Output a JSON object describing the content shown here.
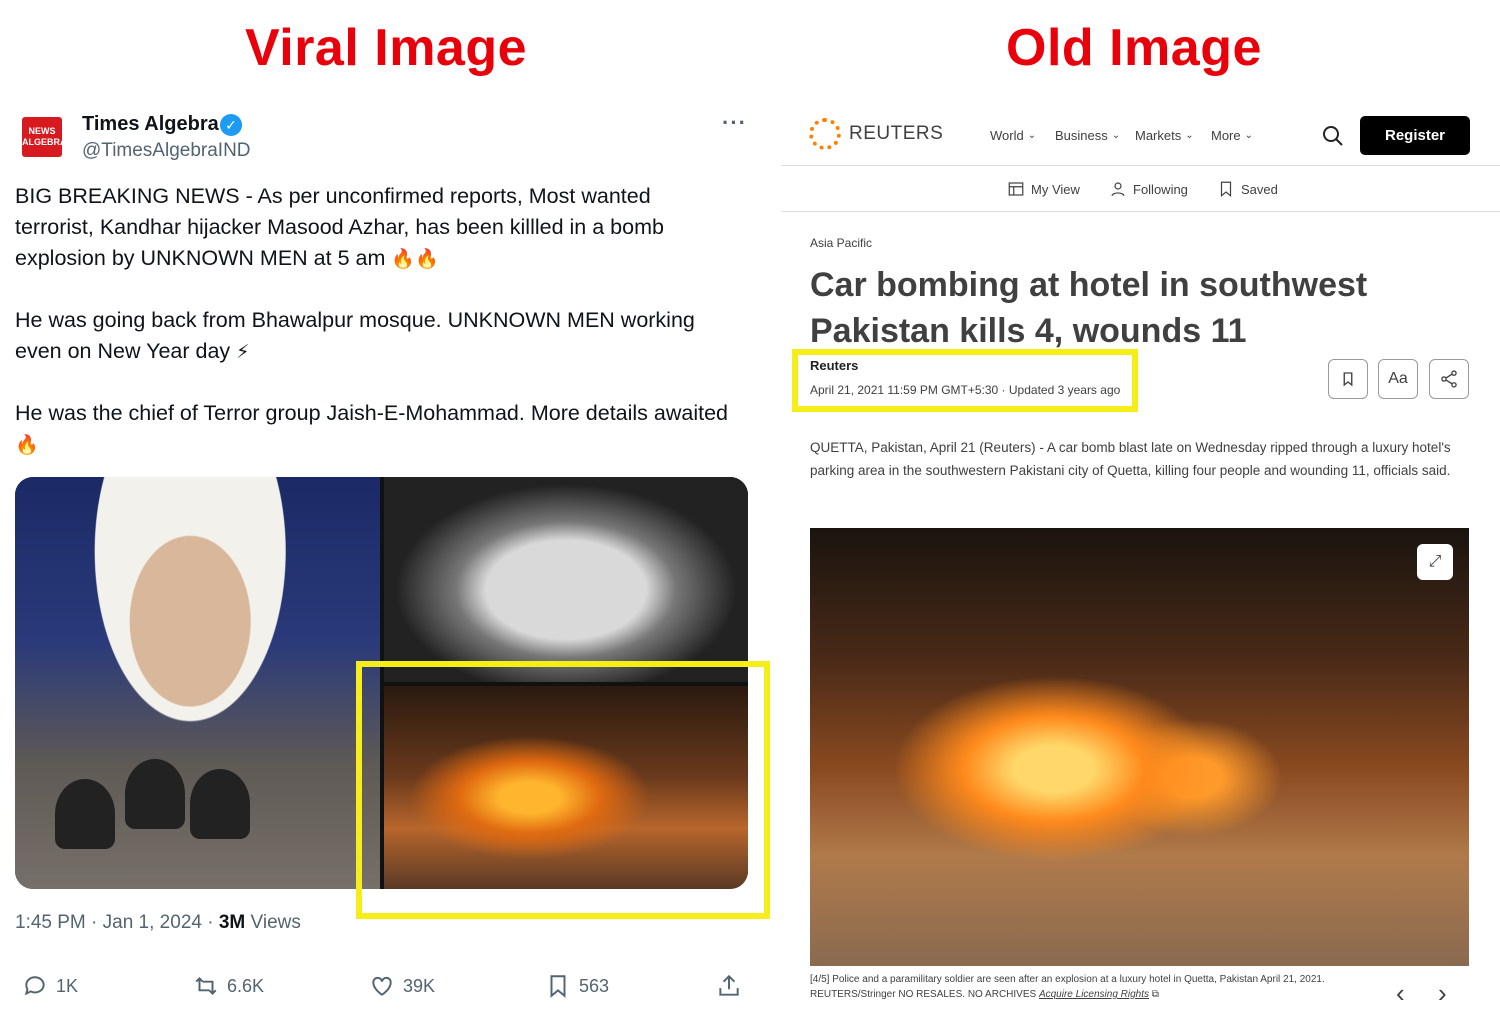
{
  "labels": {
    "left": "Viral Image",
    "right": "Old Image"
  },
  "tweet": {
    "logo_lines": [
      "NEWS",
      "ALGEBRA"
    ],
    "name": "Times Algebra",
    "verified_mark": "✓",
    "handle": "@TimesAlgebraIND",
    "more": "···",
    "p1": "BIG BREAKING NEWS - As per unconfirmed reports, Most wanted terrorist, Kandhar hijacker Masood Azhar, has been killled in a bomb explosion by UNKNOWN MEN at 5 am",
    "p1_emoji": "🔥🔥",
    "p2": "He was going back from Bhawalpur mosque. UNKNOWN MEN working even on New Year day",
    "p2_emoji": "⚡",
    "p3": "He was the chief of Terror group Jaish-E-Mohammad. More details awaited",
    "p3_emoji": "🔥",
    "time": "1:45 PM · Jan 1, 2024 · ",
    "views_count": "3M",
    "views_label": " Views",
    "actions": {
      "replies": "1K",
      "reposts": "6.6K",
      "likes": "39K",
      "bookmarks": "563"
    }
  },
  "reuters": {
    "brand": "REUTERS",
    "nav": [
      "World",
      "Business",
      "Markets",
      "More"
    ],
    "register": "Register",
    "subnav": [
      "My View",
      "Following",
      "Saved"
    ],
    "category": "Asia Pacific",
    "title": "Car bombing at hotel in southwest Pakistan kills 4, wounds 11",
    "author": "Reuters",
    "date": "April 21, 2021 11:59 PM GMT+5:30 · Updated 3 years ago",
    "font_btn": "Aa",
    "body": "QUETTA, Pakistan, April 21 (Reuters) - A car bomb blast late on Wednesday ripped through a luxury hotel's parking area in the southwestern Pakistani city of Quetta, killing four people and wounding 11, officials said.",
    "caption1": "[4/5] Police and a paramilitary soldier are seen after an explosion at a luxury hotel in Quetta, Pakistan April 21, 2021.",
    "caption2": "REUTERS/Stringer NO RESALES. NO ARCHIVES ",
    "caption_link": "Acquire Licensing Rights"
  },
  "colors": {
    "label_red": "#e8000b",
    "highlight_yellow": "#f6ee1a",
    "twitter_blue": "#1d9bf0",
    "reuters_orange": "#ff8000"
  }
}
